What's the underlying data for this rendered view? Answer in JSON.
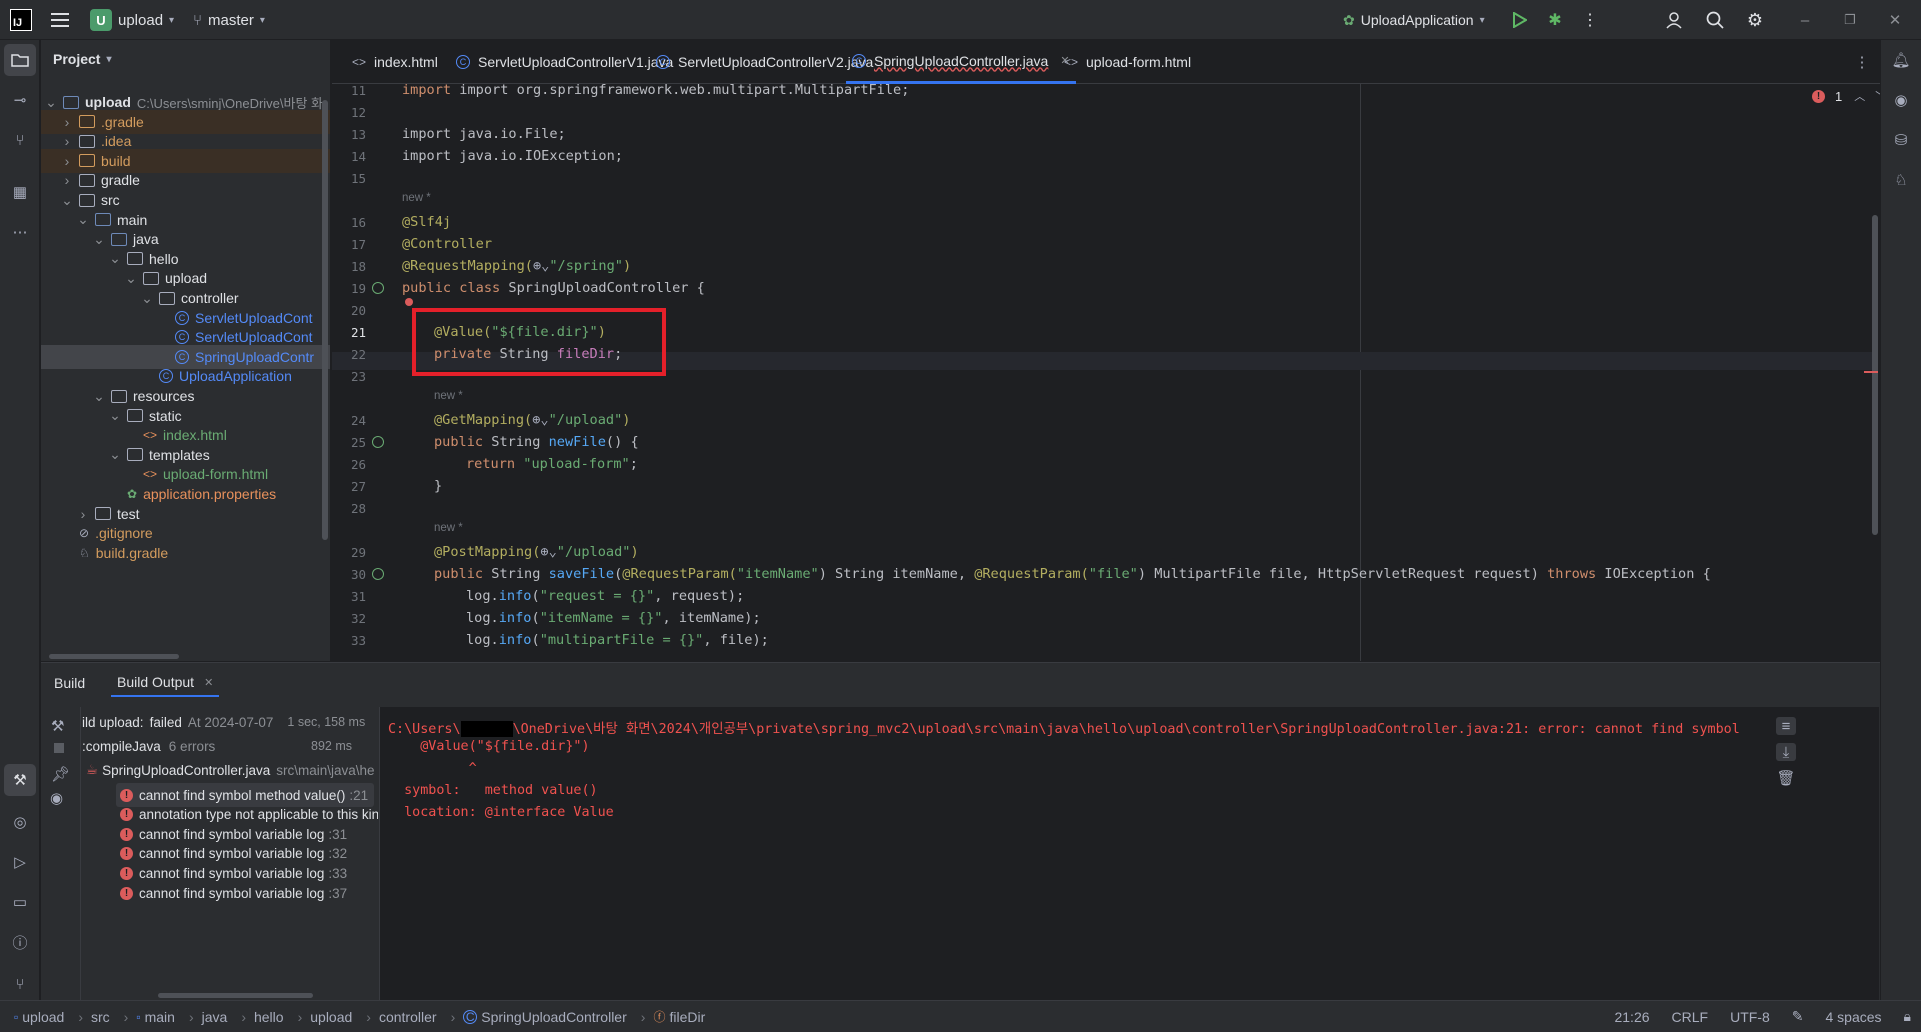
{
  "titlebar": {
    "project_badge": "U",
    "project_name": "upload",
    "branch": "master",
    "run_config": "UploadApplication"
  },
  "project_panel": {
    "title": "Project",
    "tree": [
      {
        "label": "upload",
        "hint": "C:\\Users\\sminj\\OneDrive\\바탕 화"
      },
      {
        "label": ".gradle"
      },
      {
        "label": ".idea"
      },
      {
        "label": "build"
      },
      {
        "label": "gradle"
      },
      {
        "label": "src"
      },
      {
        "label": "main"
      },
      {
        "label": "java"
      },
      {
        "label": "hello"
      },
      {
        "label": "upload"
      },
      {
        "label": "controller"
      },
      {
        "label": "ServletUploadCont"
      },
      {
        "label": "ServletUploadCont"
      },
      {
        "label": "SpringUploadContr"
      },
      {
        "label": "UploadApplication"
      },
      {
        "label": "resources"
      },
      {
        "label": "static"
      },
      {
        "label": "index.html"
      },
      {
        "label": "templates"
      },
      {
        "label": "upload-form.html"
      },
      {
        "label": "application.properties"
      },
      {
        "label": "test"
      },
      {
        "label": ".gitignore"
      },
      {
        "label": "build.gradle"
      }
    ]
  },
  "tabs": [
    {
      "label": "index.html",
      "icon": "html-icon"
    },
    {
      "label": "ServletUploadControllerV1.java",
      "icon": "class-icon"
    },
    {
      "label": "ServletUploadControllerV2.java",
      "icon": "class-icon"
    },
    {
      "label": "SpringUploadController.java",
      "icon": "class-icon",
      "active": true
    },
    {
      "label": "upload-form.html",
      "icon": "html-icon"
    }
  ],
  "editor": {
    "error_count": "1",
    "line_numbers": [
      "11",
      "12",
      "13",
      "14",
      "15",
      "16",
      "17",
      "18",
      "19",
      "20",
      "21",
      "22",
      "23",
      "24",
      "25",
      "26",
      "27",
      "28",
      "29",
      "30",
      "31",
      "32",
      "33"
    ],
    "hint_new": "new *",
    "lines": {
      "l11": "import org.springframework.web.multipart.MultipartFile;",
      "l13": "import java.io.File;",
      "l14": "import java.io.IOException;",
      "l16": "@Slf4j",
      "l17": "@Controller",
      "l18a": "@RequestMapping(",
      "l18b": "\"/spring\"",
      "l18c": ")",
      "l19a": "public class ",
      "l19b": "SpringUploadController {",
      "l21a": "@Value(",
      "l21b": "\"${file.dir}\"",
      "l21c": ")",
      "l22a": "private ",
      "l22b": "String ",
      "l22c": "fileDir",
      "l22d": ";",
      "l24a": "@GetMapping(",
      "l24b": "\"/upload\"",
      "l24c": ")",
      "l25a": "public ",
      "l25b": "String ",
      "l25c": "newFile",
      "l25d": "() {",
      "l26a": "return ",
      "l26b": "\"upload-form\"",
      "l26c": ";",
      "l27": "}",
      "l29a": "@PostMapping(",
      "l29b": "\"/upload\"",
      "l29c": ")",
      "l30a": "public ",
      "l30b": "String ",
      "l30c": "saveFile",
      "l30d": "(",
      "l30e": "@RequestParam(",
      "l30f": "\"itemName\"",
      "l30g": ") String itemName, ",
      "l30h": "@RequestParam(",
      "l30i": "\"file\"",
      "l30j": ") MultipartFile file, HttpServletRequest request) ",
      "l30k": "throws ",
      "l30l": "IOException {",
      "l31a": "log.",
      "l31b": "info",
      "l31c": "(",
      "l31d": "\"request = {}\"",
      "l31e": ", request);",
      "l32d": "\"itemName = {}\"",
      "l32e": ", itemName);",
      "l33d": "\"multipartFile = {}\"",
      "l33e": ", file);"
    }
  },
  "build_panel": {
    "tab_build": "Build",
    "tab_output": "Build Output",
    "summary_title": "ild upload:",
    "summary_status": "failed",
    "summary_time": "At 2024-07-07",
    "summary_duration": "1 sec, 158 ms",
    "task_name": ":compileJava",
    "task_errors": "6 errors",
    "task_time": "892 ms",
    "file_name": "SpringUploadController.java",
    "file_path": "src\\main\\java\\he",
    "errors": [
      {
        "text": "cannot find symbol method value()",
        "line": ":21"
      },
      {
        "text": "annotation type not applicable to this kin",
        "line": ""
      },
      {
        "text": "cannot find symbol variable log",
        "line": ":31"
      },
      {
        "text": "cannot find symbol variable log",
        "line": ":32"
      },
      {
        "text": "cannot find symbol variable log",
        "line": ":33"
      },
      {
        "text": "cannot find symbol variable log",
        "line": ":37"
      }
    ],
    "output": {
      "line1a": "C:\\Users\\",
      "line1b": "\\OneDrive\\바탕 화면\\2024\\개인공부\\private\\spring_mvc2\\upload\\src\\main\\java\\hello\\upload\\controller\\SpringUploadController.java:21: error: cannot find symbol",
      "line2": "    @Value(\"${file.dir}\")",
      "line3": "          ^",
      "line4": "  symbol:   method value()",
      "line5": "  location: @interface Value"
    }
  },
  "statusbar": {
    "breadcrumbs": [
      "upload",
      "src",
      "main",
      "java",
      "hello",
      "upload",
      "controller",
      "SpringUploadController",
      "fileDir"
    ],
    "position": "21:26",
    "line_sep": "CRLF",
    "encoding": "UTF-8",
    "indent": "4 spaces"
  },
  "colors": {
    "accent": "#3574f0",
    "error": "#db5c5c",
    "highlight_box": "#e5202a"
  }
}
